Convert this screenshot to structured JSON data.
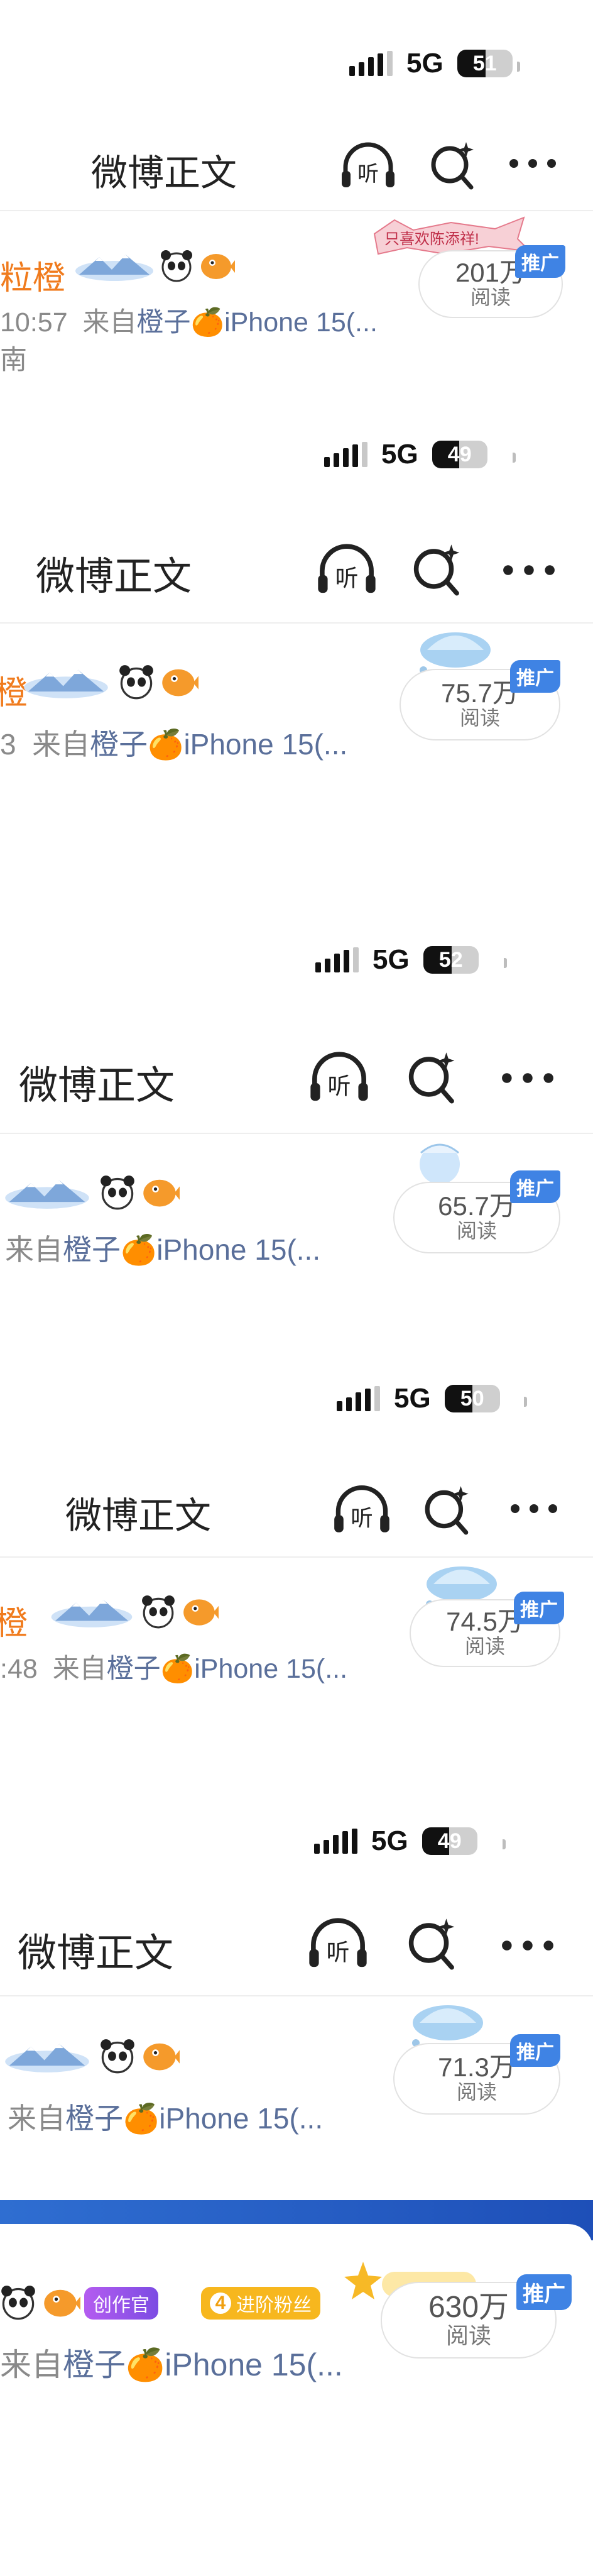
{
  "nav_title": "微博正文",
  "network": "5G",
  "source_prefix": "来自",
  "source_app": "橙子",
  "source_device": "iPhone 15(...",
  "read_unit": "阅读",
  "ad_label": "推广",
  "segments": [
    {
      "battery": "51",
      "name": "粒橙",
      "time": "10:57",
      "location": "南",
      "reads": "201万",
      "banner": "只喜欢陈添祥!"
    },
    {
      "battery": "49",
      "name": "橙",
      "time": "3",
      "reads": "75.7万"
    },
    {
      "battery": "52",
      "name": "",
      "time": "",
      "reads": "65.7万"
    },
    {
      "battery": "50",
      "name": "橙",
      "time": ":48",
      "reads": "74.5万"
    },
    {
      "battery": "49",
      "name": "",
      "time": "",
      "reads": "71.3万"
    },
    {
      "reads": "630万",
      "badge_creator": "创作官",
      "badge_fans": "进阶粉丝",
      "badge_level": "4"
    }
  ],
  "colors": {
    "accent_orange": "#f07b1d",
    "link": "#5a6f9a",
    "ad_blue": "#3f83e4",
    "banner_blue": "#1e4fb8"
  }
}
